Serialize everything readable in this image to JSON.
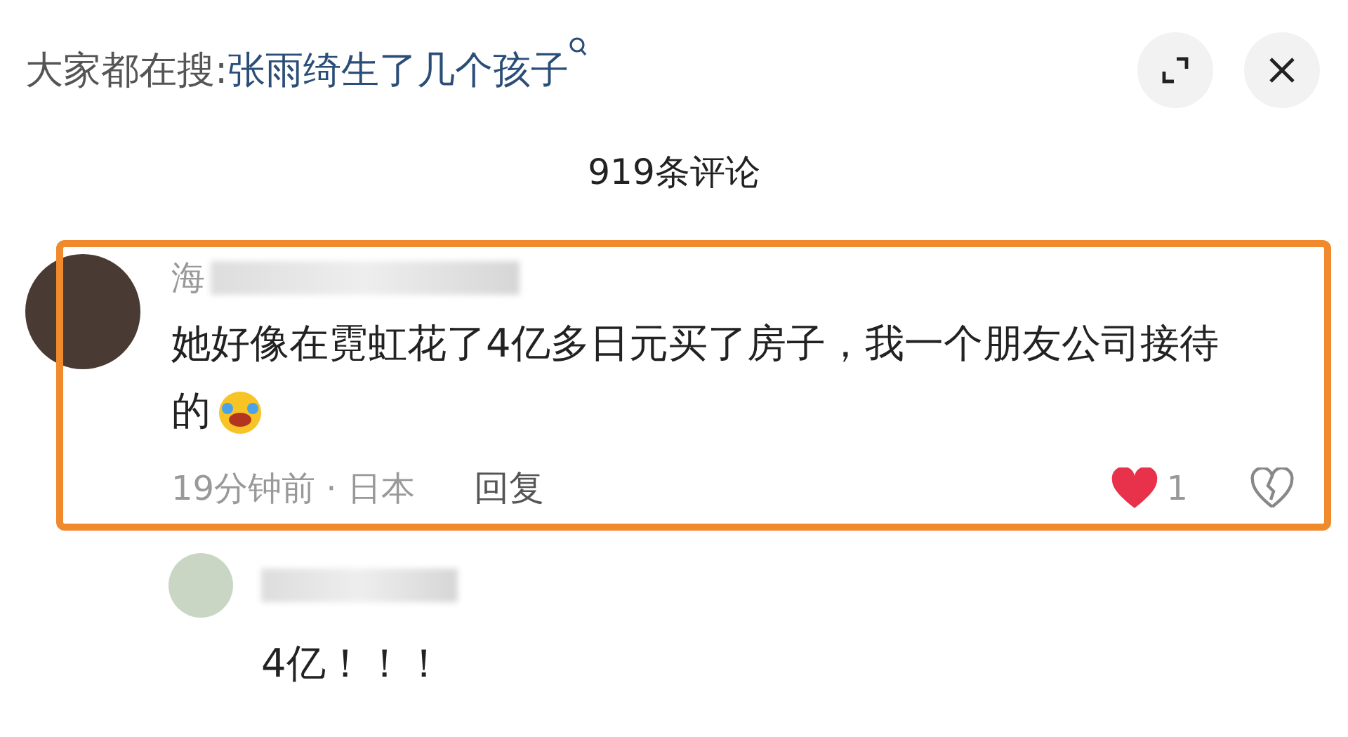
{
  "header": {
    "prefix": "大家都在搜:",
    "query": "张雨绮生了几个孩子"
  },
  "comment_count": "919条评论",
  "comments": [
    {
      "username": "海",
      "username_blurred": true,
      "text": "她好像在霓虹花了4亿多日元买了房子，我一个朋友公司接待的",
      "has_emoji": true,
      "time": "19分钟前 · 日本",
      "reply_label": "回复",
      "likes": "1",
      "liked": true,
      "highlighted": true
    }
  ],
  "replies": [
    {
      "username_blurred": true,
      "text": "4亿！！！"
    }
  ]
}
